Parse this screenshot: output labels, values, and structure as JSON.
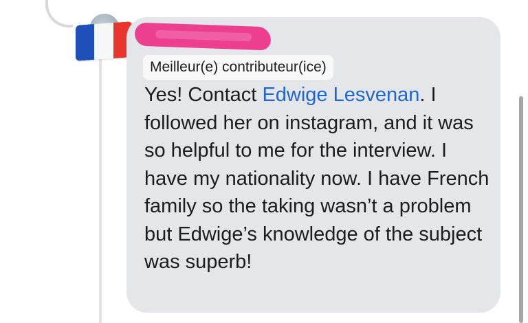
{
  "comment": {
    "badge_label": "Meilleur(e) contributeur(ice)",
    "text_before_link": "Yes! Contact ",
    "mention_link": "Edwige Lesvenan",
    "text_after_link": ". I followed her on instagram, and it was so helpful to me for the interview. I have my nationality now. I have French family so the taking wasn’t a problem but Edwige’s knowledge of the subject was superb!"
  },
  "icons": {
    "flag": "france-flag-icon",
    "avatar": "avatar"
  },
  "colors": {
    "bubble_background": "#e5e6ea",
    "link": "#1e66cf",
    "redaction": "#ec3f8f",
    "flag_blue": "#1f4fb8",
    "flag_red": "#e8352e"
  }
}
